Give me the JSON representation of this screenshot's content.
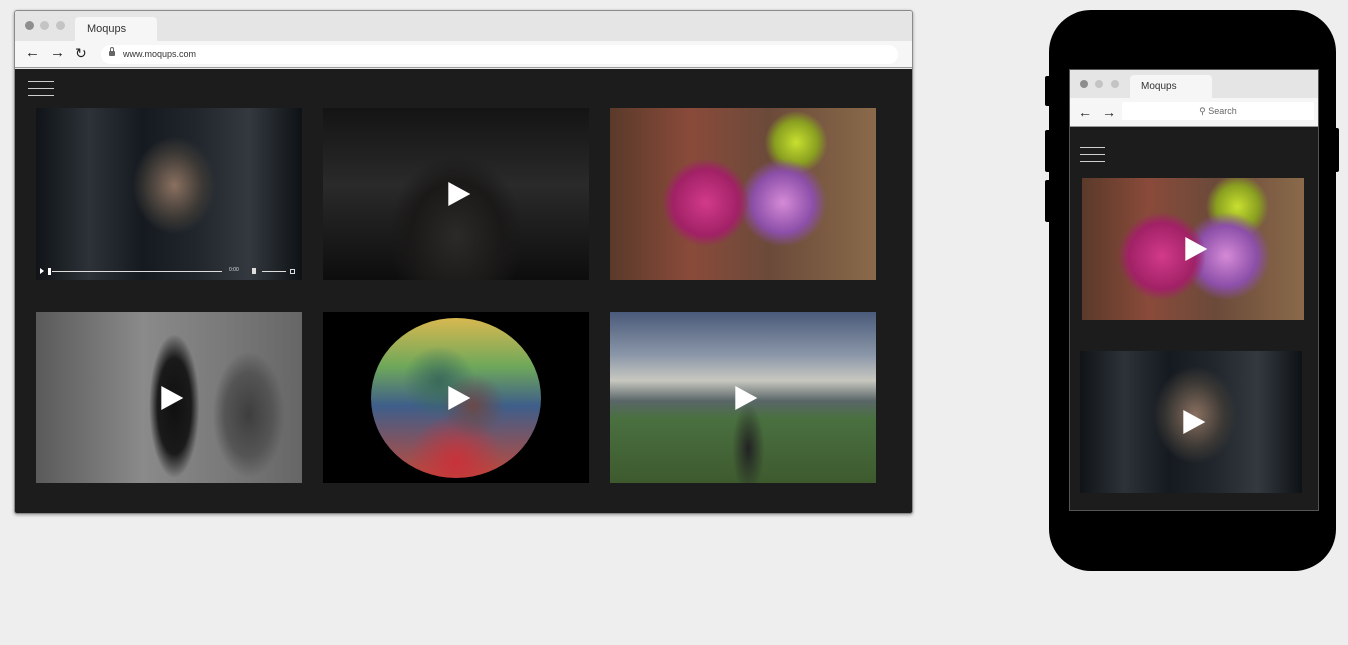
{
  "desktop": {
    "tab_title": "Moqups",
    "url": "www.moqups.com",
    "player_time": "0:00"
  },
  "mobile": {
    "tab_title": "Moqups",
    "search_placeholder": "Search"
  },
  "icons": {
    "back": "arrow-left",
    "forward": "arrow-right",
    "reload": "reload",
    "menu": "hamburger",
    "play": "play"
  },
  "colors": {
    "page_background": "#eeeeee",
    "viewport_background": "#1c1c1c",
    "phone_body": "#000000"
  }
}
